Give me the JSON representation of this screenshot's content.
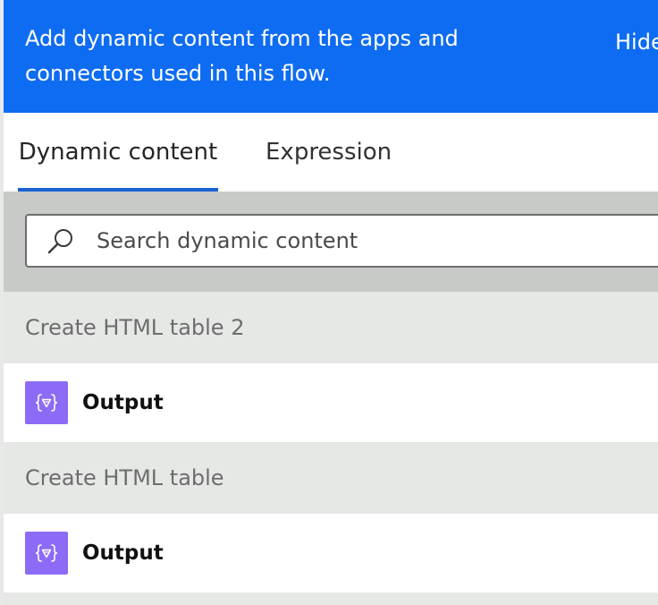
{
  "panel": {
    "header_text": "Add dynamic content from the apps and connectors used in this flow.",
    "hide_label": "Hide"
  },
  "tabs": [
    {
      "label": "Dynamic content",
      "active": true
    },
    {
      "label": "Expression",
      "active": false
    }
  ],
  "search": {
    "placeholder": "Search dynamic content",
    "icon": "search-icon"
  },
  "sections": [
    {
      "title": "Create HTML table 2",
      "items": [
        {
          "label": "Output",
          "icon": "variable-braces-icon"
        }
      ]
    },
    {
      "title": "Create HTML table",
      "items": [
        {
          "label": "Output",
          "icon": "variable-braces-icon"
        }
      ]
    }
  ],
  "colors": {
    "header_bg": "#0e6cf2",
    "tab_underline": "#1a63d3",
    "search_band_bg": "#c8cac8",
    "section_bg": "#e6e8e6",
    "item_icon_bg": "#8c6cf6"
  }
}
